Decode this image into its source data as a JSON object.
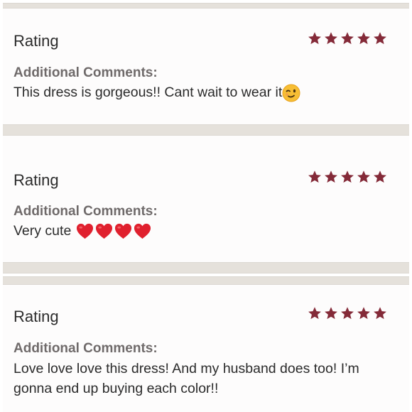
{
  "colors": {
    "star": "#842a38",
    "heart": "#e0202e",
    "wink_face": "#f7be34"
  },
  "reviews": [
    {
      "rating_label": "Rating",
      "stars": 5,
      "comments_label": "Additional Comments:",
      "comment": "This dress is gorgeous!! Cant wait to wear it",
      "emojis": [
        "winking-face-emoji"
      ]
    },
    {
      "rating_label": "Rating",
      "stars": 5,
      "comments_label": "Additional Comments:",
      "comment": "Very cute",
      "emojis": [
        "heart-emoji",
        "heart-emoji",
        "heart-emoji",
        "heart-emoji"
      ]
    },
    {
      "rating_label": "Rating",
      "stars": 5,
      "comments_label": "Additional Comments:",
      "comment": "Love love love this dress! And my husband does too! I’m gonna end up buying each color!!",
      "emojis": []
    }
  ]
}
